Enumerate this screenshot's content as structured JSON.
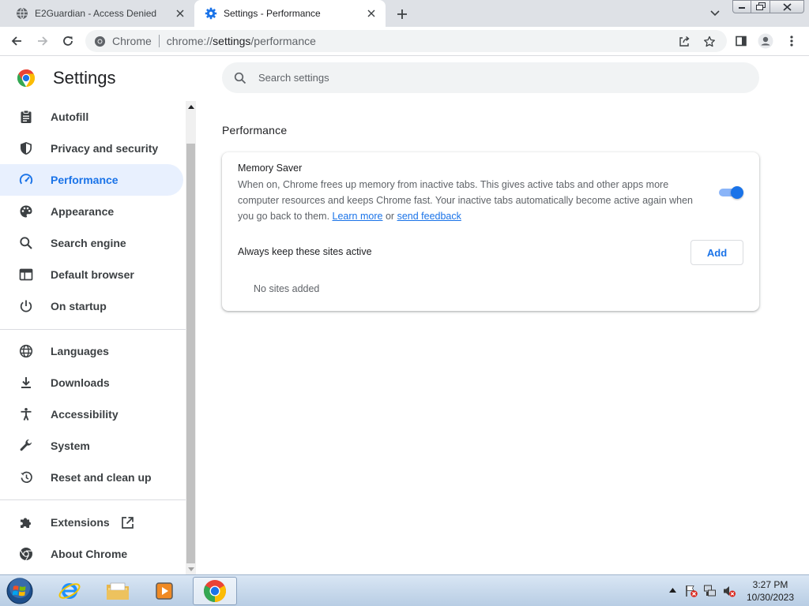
{
  "tabs": [
    {
      "title": "E2Guardian - Access Denied",
      "favicon": "globe-icon"
    },
    {
      "title": "Settings - Performance",
      "favicon": "gear-icon",
      "active": true
    }
  ],
  "toolbar": {
    "origin_label": "Chrome",
    "url_scheme": "chrome://",
    "url_host": "settings",
    "url_path": "/performance"
  },
  "settings": {
    "title": "Settings",
    "search_placeholder": "Search settings",
    "nav": [
      {
        "label": "Autofill",
        "icon": "clipboard-icon"
      },
      {
        "label": "Privacy and security",
        "icon": "shield-icon"
      },
      {
        "label": "Performance",
        "icon": "speedometer-icon",
        "selected": true
      },
      {
        "label": "Appearance",
        "icon": "palette-icon"
      },
      {
        "label": "Search engine",
        "icon": "search-icon"
      },
      {
        "label": "Default browser",
        "icon": "browser-window-icon"
      },
      {
        "label": "On startup",
        "icon": "power-icon"
      },
      {
        "label": "Languages",
        "icon": "globe-icon"
      },
      {
        "label": "Downloads",
        "icon": "download-icon"
      },
      {
        "label": "Accessibility",
        "icon": "accessibility-icon"
      },
      {
        "label": "System",
        "icon": "wrench-icon"
      },
      {
        "label": "Reset and clean up",
        "icon": "history-icon"
      },
      {
        "label": "Extensions",
        "icon": "puzzle-icon"
      },
      {
        "label": "About Chrome",
        "icon": "chrome-logo-icon"
      }
    ]
  },
  "performance": {
    "section_title": "Performance",
    "memory_saver": {
      "title": "Memory Saver",
      "description": "When on, Chrome frees up memory from inactive tabs. This gives active tabs and other apps more computer resources and keeps Chrome fast. Your inactive tabs automatically become active again when you go back to them.",
      "learn_more": "Learn more",
      "or_text": "or",
      "feedback": "send feedback",
      "enabled": true
    },
    "keep_active_label": "Always keep these sites active",
    "add_button": "Add",
    "no_sites": "No sites added"
  },
  "taskbar": {
    "time": "3:27 PM",
    "date": "10/30/2023"
  },
  "colors": {
    "accent": "#1a73e8",
    "selected_nav_bg": "#e8f0fe",
    "tab_strip": "#dee1e6"
  }
}
